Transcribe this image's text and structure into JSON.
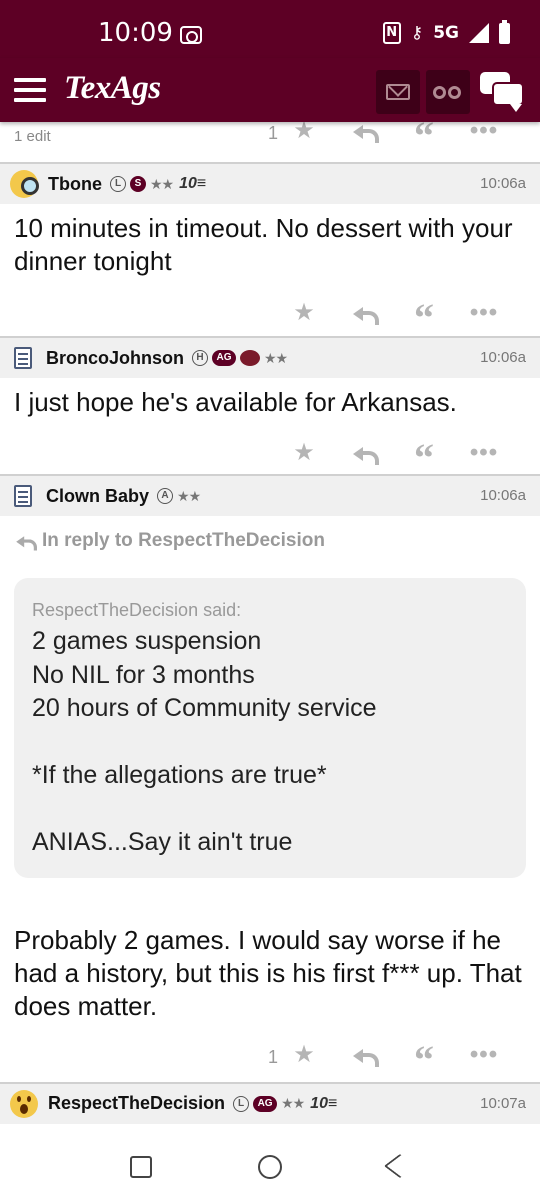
{
  "status_bar": {
    "time": "10:09",
    "network": "5G"
  },
  "app": {
    "logo": "TexAgs",
    "icons": [
      "menu-icon",
      "mail-icon",
      "binoculars-icon",
      "chat-icon"
    ],
    "brand_color": "#5d0025"
  },
  "prev_post_footer": {
    "edit_text": "1 edit",
    "like_count": "1"
  },
  "posts": [
    {
      "username": "Tbone",
      "badges": [
        "L",
        "S"
      ],
      "stars": "★★",
      "rank": "10",
      "time": "10:06a",
      "body": "10 minutes in timeout. No dessert with your dinner tonight",
      "like_count": ""
    },
    {
      "username": "BroncoJohnson",
      "badges": [
        "H",
        "AG"
      ],
      "stars": "★★",
      "time": "10:06a",
      "body": "I just hope he's available for Arkansas.",
      "like_count": ""
    },
    {
      "username": "Clown Baby",
      "badges": [
        "A"
      ],
      "stars": "★★",
      "time": "10:06a",
      "in_reply_to": "In reply to RespectTheDecision",
      "quote": {
        "author": "RespectTheDecision said:",
        "lines": [
          "2 games suspension",
          "No NIL for 3 months",
          "20 hours of Community service",
          "",
          "*If the allegations are true*",
          "",
          "ANIAS...Say it ain't true"
        ]
      },
      "body": "Probably 2 games. I would say worse if he had a history, but this is his first f*** up. That does matter.",
      "like_count": "1"
    },
    {
      "username": "RespectTheDecision",
      "badges": [
        "L",
        "AG"
      ],
      "stars": "★★",
      "rank": "10",
      "time": "10:07a"
    }
  ]
}
